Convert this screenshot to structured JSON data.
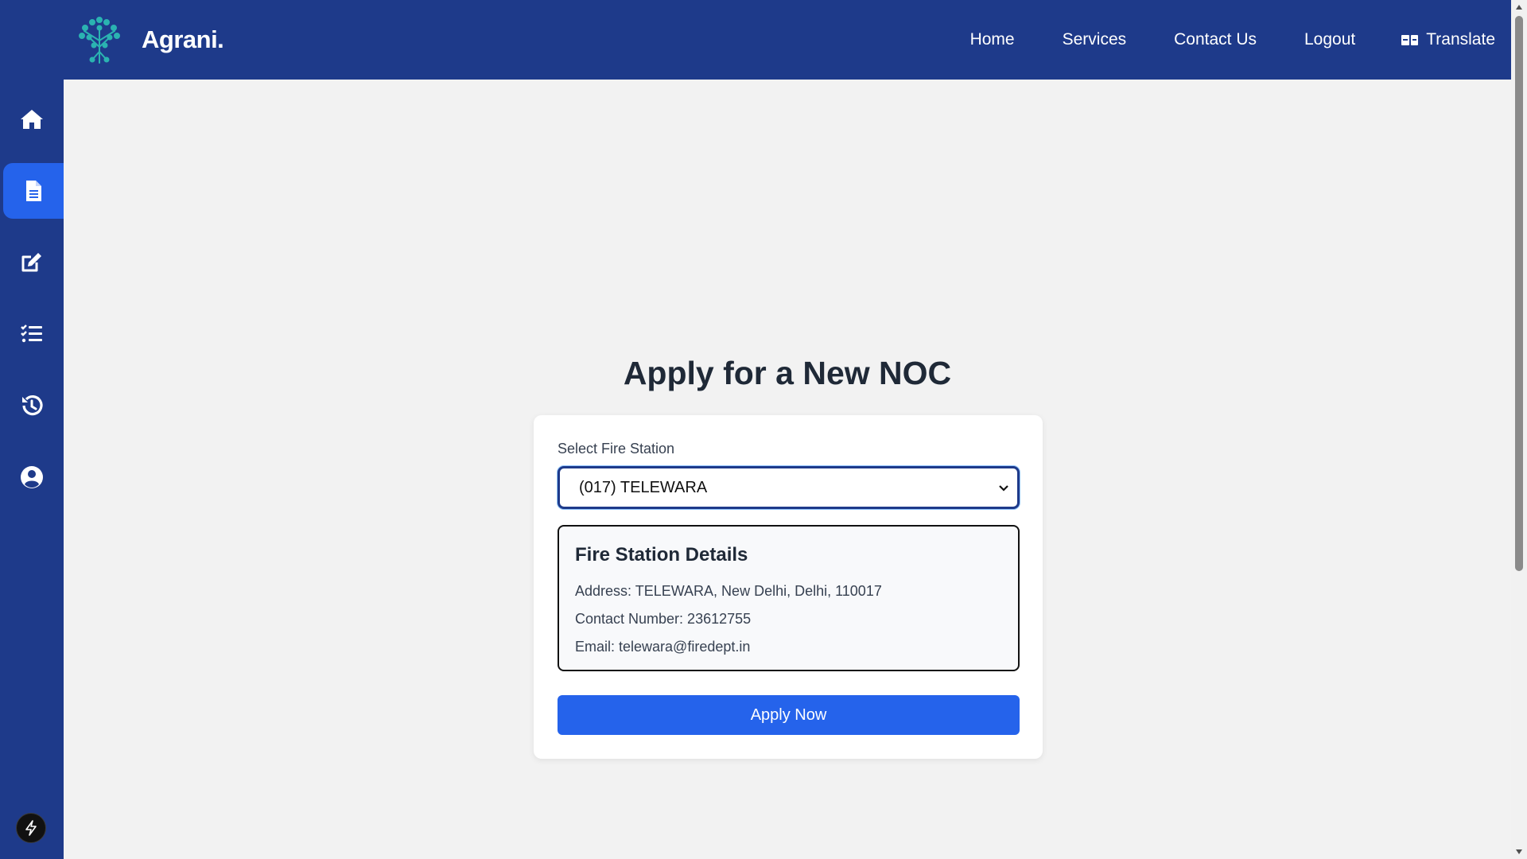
{
  "header": {
    "brand": "Agrani.",
    "nav": [
      "Home",
      "Services",
      "Contact Us",
      "Logout"
    ],
    "translate_label": "Translate"
  },
  "sidebar": {
    "items": [
      {
        "icon": "home-icon"
      },
      {
        "icon": "document-icon",
        "active": true
      },
      {
        "icon": "edit-icon"
      },
      {
        "icon": "checklist-icon"
      },
      {
        "icon": "history-icon"
      },
      {
        "icon": "user-circle-icon"
      }
    ]
  },
  "main": {
    "title": "Apply for a New NOC",
    "form": {
      "station_label": "Select Fire Station",
      "station_value": "(017) TELEWARA",
      "details_title": "Fire Station Details",
      "address": "Address: TELEWARA, New Delhi, Delhi, 110017",
      "contact": "Contact Number: 23612755",
      "email": "Email: telewara@firedept.in",
      "apply_label": "Apply Now"
    }
  },
  "colors": {
    "navy": "#1e3a8a",
    "accent": "#2563eb",
    "logo": "#2bb3b1",
    "background": "#f2f2f2"
  }
}
